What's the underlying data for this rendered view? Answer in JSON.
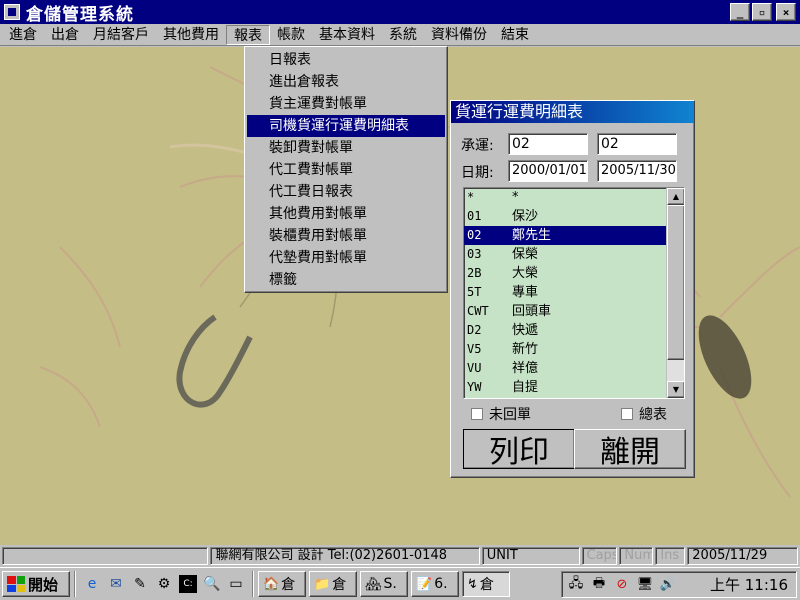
{
  "window": {
    "title": "倉儲管理系統",
    "minimize": "_",
    "maximize": "▫",
    "close": "×"
  },
  "menubar": {
    "items": [
      {
        "label": "進倉"
      },
      {
        "label": "出倉"
      },
      {
        "label": "月結客戶"
      },
      {
        "label": "其他費用"
      },
      {
        "label": "報表"
      },
      {
        "label": "帳款"
      },
      {
        "label": "基本資料"
      },
      {
        "label": "系統"
      },
      {
        "label": "資料備份"
      },
      {
        "label": "結束"
      }
    ]
  },
  "report_menu": {
    "items": [
      {
        "label": "日報表"
      },
      {
        "label": "進出倉報表"
      },
      {
        "label": "貨主運費對帳單"
      },
      {
        "label": "司機貨運行運費明細表"
      },
      {
        "label": "裝卸費對帳單"
      },
      {
        "label": "代工費對帳單"
      },
      {
        "label": "代工費日報表"
      },
      {
        "label": "其他費用對帳單"
      },
      {
        "label": "裝櫃費用對帳單"
      },
      {
        "label": "代墊費用對帳單"
      },
      {
        "label": "標籤"
      }
    ]
  },
  "dialog": {
    "title": "貨運行運費明細表",
    "carrier_label": "承運:",
    "carrier_from": "02",
    "carrier_to": "02",
    "date_label": "日期:",
    "date_from": "2000/01/01",
    "date_to": "2005/11/30",
    "list": [
      {
        "code": "*",
        "name": "*"
      },
      {
        "code": "01",
        "name": "保沙"
      },
      {
        "code": "02",
        "name": "鄭先生"
      },
      {
        "code": "03",
        "name": "保榮"
      },
      {
        "code": "2B",
        "name": "大榮"
      },
      {
        "code": "5T",
        "name": "專車"
      },
      {
        "code": "CWT",
        "name": "回頭車"
      },
      {
        "code": "D2",
        "name": "快遞"
      },
      {
        "code": "V5",
        "name": "新竹"
      },
      {
        "code": "VU",
        "name": "祥億"
      },
      {
        "code": "YW",
        "name": "自提"
      }
    ],
    "scroll_up": "▲",
    "scroll_down": "▼",
    "unreturned_label": "未回單",
    "summary_label": "總表",
    "print_label": "列印",
    "exit_label": "離開"
  },
  "statusbar": {
    "company": "聯網有限公司 設計 Tel:(02)2601-0148",
    "unit": "UNIT",
    "caps": "Caps",
    "num": "Num",
    "ins": "Ins",
    "date": "2005/11/29"
  },
  "taskbar": {
    "start_label": "開始",
    "tasks": [
      {
        "label": "倉",
        "icon": "🏠"
      },
      {
        "label": "倉",
        "icon": "📁"
      },
      {
        "label": "S.",
        "icon": "🏘"
      },
      {
        "label": "6.",
        "icon": "📝"
      },
      {
        "label": "倉",
        "icon": "↯"
      }
    ],
    "clock": "上午 11:16"
  },
  "colors": {
    "workspace": "#c5bd86",
    "selection": "#000080",
    "list_background": "#c7e3c7"
  }
}
